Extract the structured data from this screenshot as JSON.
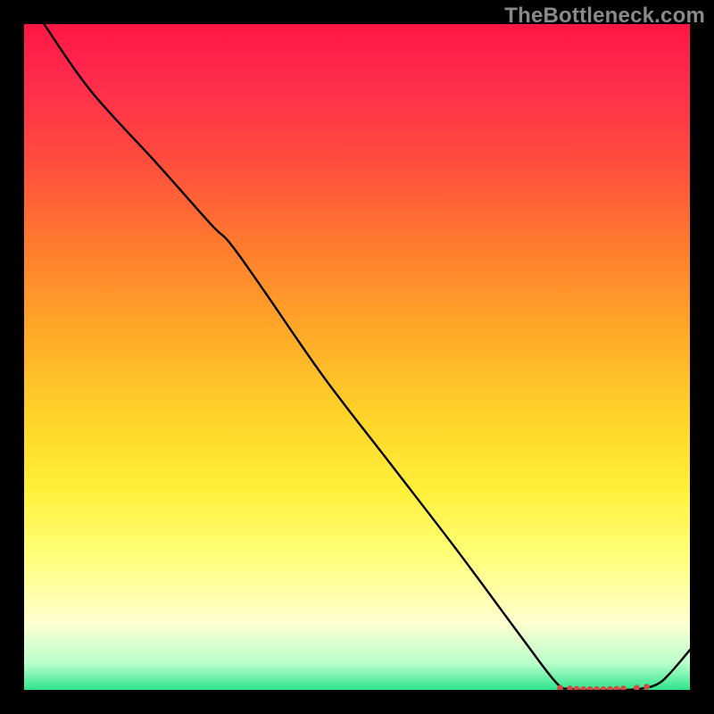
{
  "watermark": "TheBottleneck.com",
  "chart_data": {
    "type": "line",
    "title": "",
    "xlabel": "",
    "ylabel": "",
    "xlim": [
      0,
      100
    ],
    "ylim": [
      0,
      100
    ],
    "grid": false,
    "legend": false,
    "background_gradient": [
      "#ff1744",
      "#ff7a2e",
      "#ffd028",
      "#ffff7a",
      "#2ee58a"
    ],
    "series": [
      {
        "name": "bottleneck-curve",
        "color": "#000000",
        "x": [
          3,
          10,
          20,
          28,
          31,
          36,
          45,
          55,
          65,
          75,
          80,
          82,
          84,
          88,
          92,
          95,
          97,
          100
        ],
        "values": [
          100,
          90,
          79,
          70,
          67,
          60,
          47,
          34,
          21,
          7.5,
          1.0,
          0.2,
          0,
          0,
          0.1,
          0.8,
          2.5,
          6
        ]
      }
    ],
    "markers": {
      "name": "optimal-points",
      "color": "#d24a42",
      "x": [
        80.5,
        82,
        83,
        84,
        85,
        86,
        87,
        88,
        89,
        90,
        92,
        93.5
      ],
      "values": [
        0.3,
        0.2,
        0.15,
        0.1,
        0.1,
        0.1,
        0.1,
        0.12,
        0.15,
        0.2,
        0.3,
        0.45
      ]
    }
  }
}
